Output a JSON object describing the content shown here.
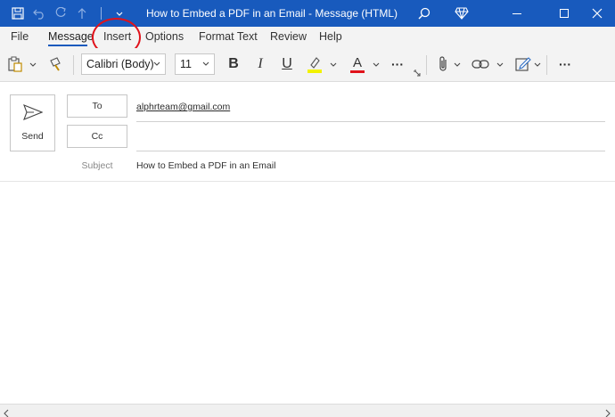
{
  "titlebar": {
    "title": "How to Embed a PDF in an Email  -  Message (HTML)",
    "bg_color": "#185abd",
    "icons": [
      "save-icon",
      "undo-icon",
      "redo-icon",
      "up-arrow-icon",
      "customize-chevron-icon",
      "search-icon",
      "diamond-icon"
    ],
    "window_buttons": [
      "minimize-icon",
      "maximize-icon",
      "close-icon"
    ]
  },
  "ribbon": {
    "tabs": [
      {
        "label": "File"
      },
      {
        "label": "Message"
      },
      {
        "label": "Insert"
      },
      {
        "label": "Options"
      },
      {
        "label": "Format Text"
      },
      {
        "label": "Review"
      },
      {
        "label": "Help"
      }
    ],
    "active_tab": "Message",
    "highlighted_tab": "Insert",
    "highlight_color": "#e0121b",
    "font_name": "Calibri (Body)",
    "font_size": "11",
    "bold_label": "B",
    "italic_label": "I",
    "underline_label": "U",
    "font_color_label": "A",
    "highlight_swatch_color": "#f2f200",
    "font_color_swatch_color": "#e0121b",
    "more_label": "···"
  },
  "compose": {
    "send_label": "Send",
    "to_label": "To",
    "cc_label": "Cc",
    "subject_label": "Subject",
    "to_value": "alphrteam@gmail.com",
    "cc_value": "",
    "subject_value": "How to Embed a PDF in an Email"
  }
}
